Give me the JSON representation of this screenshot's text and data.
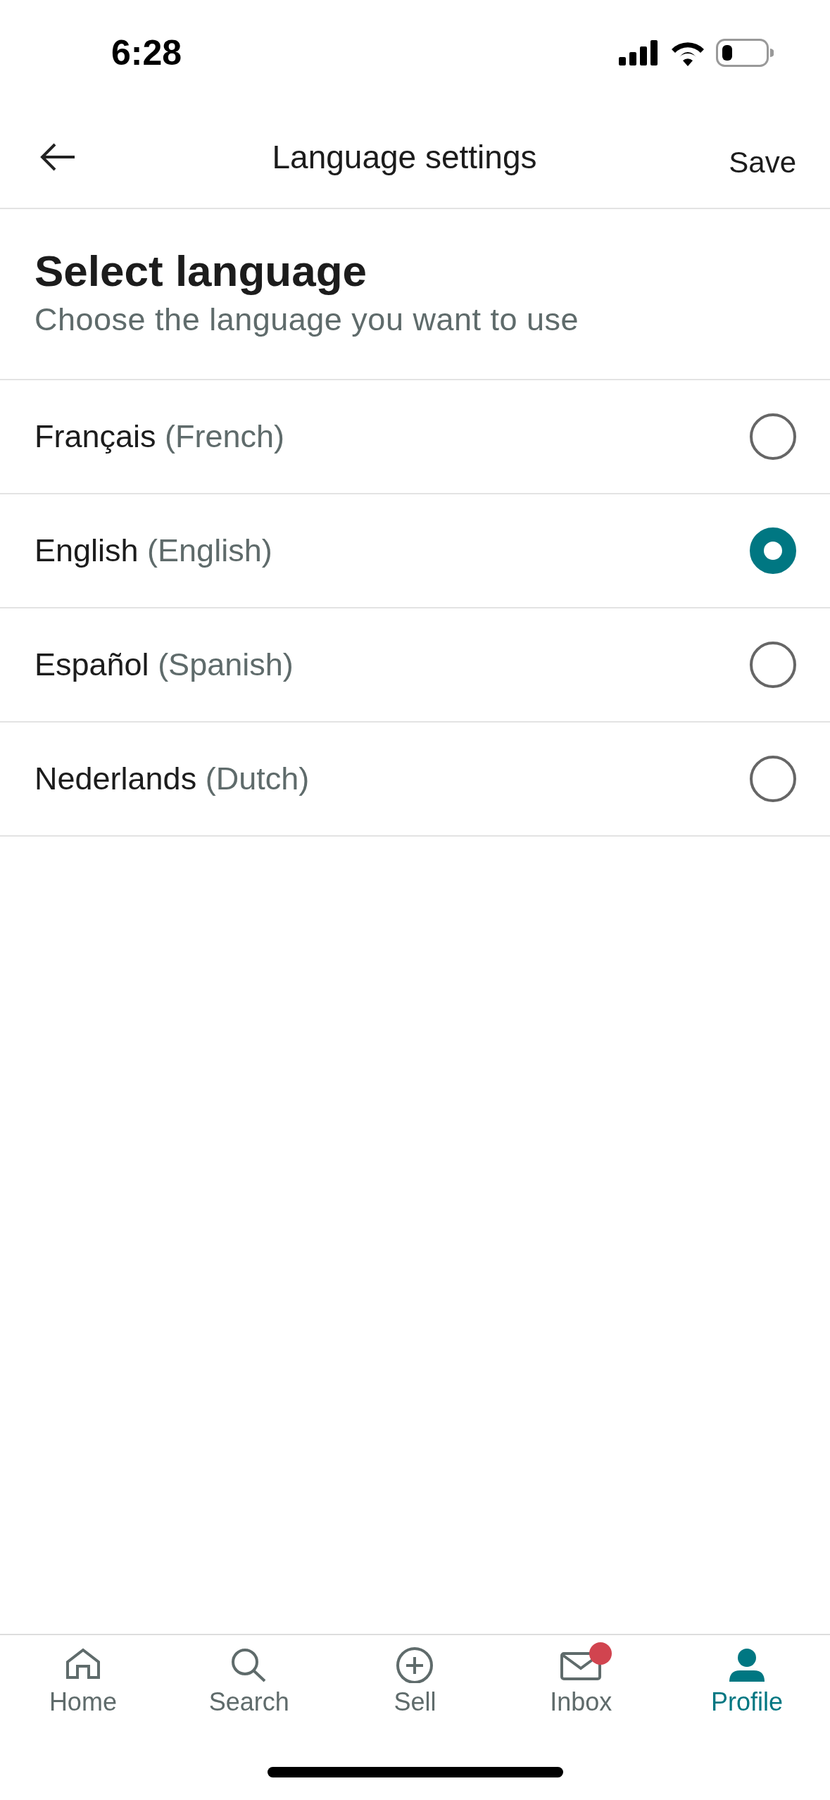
{
  "status_bar": {
    "time": "6:28"
  },
  "header": {
    "title": "Language settings",
    "action": "Save"
  },
  "intro": {
    "title": "Select language",
    "subtitle": "Choose the language you want to use"
  },
  "languages": [
    {
      "name": "Français",
      "translation": "(French)",
      "selected": false
    },
    {
      "name": "English",
      "translation": "(English)",
      "selected": true
    },
    {
      "name": "Español",
      "translation": "(Spanish)",
      "selected": false
    },
    {
      "name": "Nederlands",
      "translation": "(Dutch)",
      "selected": false
    }
  ],
  "tab_bar": [
    {
      "kind": "home",
      "label": "Home",
      "selected": false,
      "badge": false
    },
    {
      "kind": "search",
      "label": "Search",
      "selected": false,
      "badge": false
    },
    {
      "kind": "sell",
      "label": "Sell",
      "selected": false,
      "badge": false
    },
    {
      "kind": "inbox",
      "label": "Inbox",
      "selected": false,
      "badge": true
    },
    {
      "kind": "profile",
      "label": "Profile",
      "selected": true,
      "badge": false
    }
  ]
}
